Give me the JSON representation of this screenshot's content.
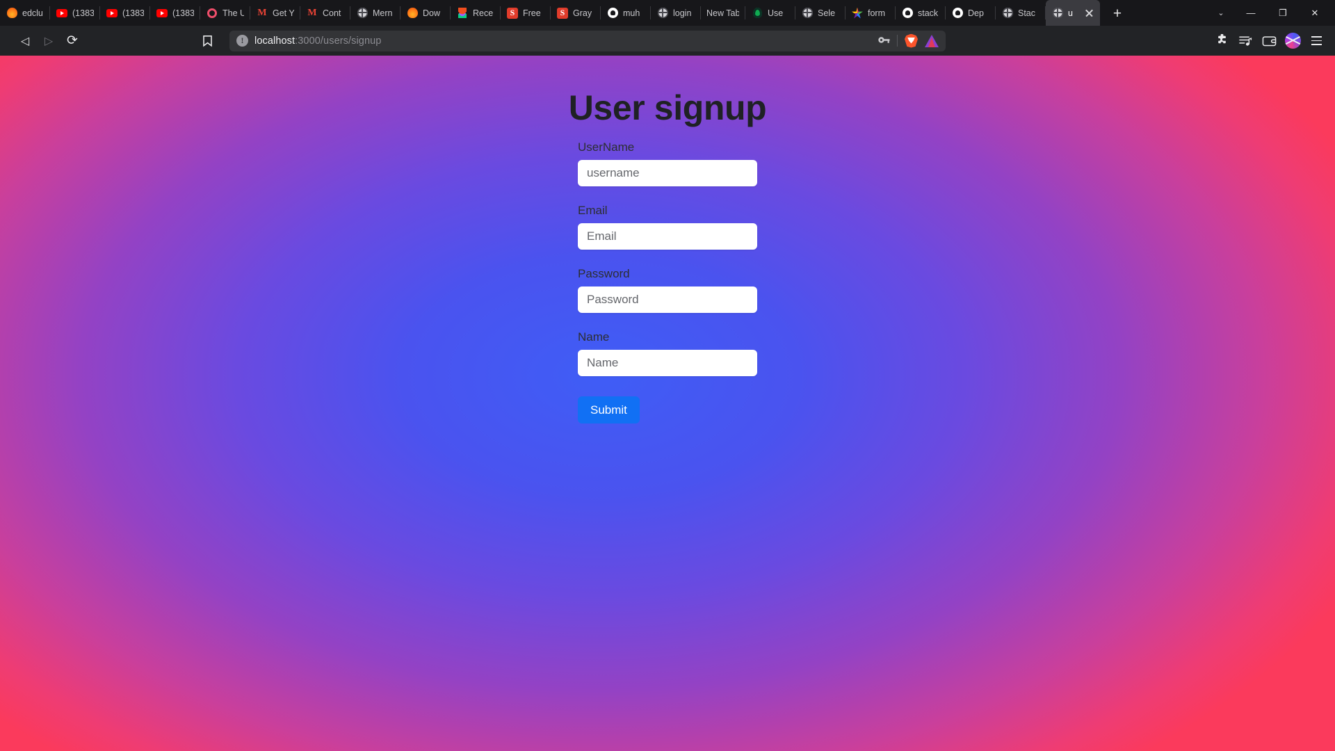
{
  "browser": {
    "tabs": [
      {
        "title": "edclu",
        "icon": "firefox-icon",
        "icon_class": "fav-fire",
        "active": false
      },
      {
        "title": "(1383",
        "icon": "youtube-icon",
        "icon_class": "fav-yt",
        "active": false
      },
      {
        "title": "(1383",
        "icon": "youtube-icon",
        "icon_class": "fav-yt",
        "active": false
      },
      {
        "title": "(1383",
        "icon": "youtube-icon",
        "icon_class": "fav-yt",
        "active": false
      },
      {
        "title": "The U",
        "icon": "ring-icon",
        "icon_class": "fav-ring",
        "active": false
      },
      {
        "title": "Get Y",
        "icon": "gmail-icon",
        "icon_class": "fav-gmail",
        "active": false
      },
      {
        "title": "Cont",
        "icon": "gmail-icon",
        "icon_class": "fav-gmail",
        "active": false
      },
      {
        "title": "Mern",
        "icon": "globe-icon",
        "icon_class": "fav-globe",
        "active": false
      },
      {
        "title": "Dow",
        "icon": "firefox-icon",
        "icon_class": "fav-fire",
        "active": false
      },
      {
        "title": "Rece",
        "icon": "figma-icon",
        "icon_class": "fav-figma",
        "active": false
      },
      {
        "title": "Free",
        "icon": "s-icon",
        "icon_class": "fav-s",
        "active": false
      },
      {
        "title": "Gray",
        "icon": "s-icon",
        "icon_class": "fav-s",
        "active": false
      },
      {
        "title": "muh",
        "icon": "github-icon",
        "icon_class": "fav-gh",
        "active": false
      },
      {
        "title": "login",
        "icon": "globe-icon",
        "icon_class": "fav-globe",
        "active": false
      },
      {
        "title": "New Tab",
        "icon": "none",
        "icon_class": "fav-none",
        "active": false
      },
      {
        "title": "Use",
        "icon": "mongodb-icon",
        "icon_class": "fav-leaf",
        "active": false
      },
      {
        "title": "Sele",
        "icon": "globe-icon",
        "icon_class": "fav-globe",
        "active": false
      },
      {
        "title": "form",
        "icon": "star-icon",
        "icon_class": "fav-star",
        "active": false
      },
      {
        "title": "stack",
        "icon": "github-icon",
        "icon_class": "fav-gh",
        "active": false
      },
      {
        "title": "Dep",
        "icon": "github-icon",
        "icon_class": "fav-gh",
        "active": false
      },
      {
        "title": "Stac",
        "icon": "globe-icon",
        "icon_class": "fav-globe",
        "active": false
      },
      {
        "title": "u",
        "icon": "globe-icon",
        "icon_class": "fav-globe",
        "active": true
      }
    ],
    "new_tab_label": "+",
    "window_controls": {
      "tab_list_chevron": "⌄",
      "minimize": "—",
      "maximize": "❐",
      "close": "✕"
    },
    "nav": {
      "back": "◁",
      "forward": "▷",
      "reload": "⟳",
      "bookmark": "☐"
    },
    "url": {
      "host": "localhost",
      "path": ":3000/users/signup",
      "full": "localhost:3000/users/signup",
      "info_icon": "not-secure-icon",
      "info_glyph": "!",
      "password_key_icon": "⚷",
      "shield_icon": "brave-shield-icon",
      "reward_icon": "brave-rewards-icon"
    },
    "toolbar_right": [
      {
        "name": "extensions-icon",
        "glyph": "❖"
      },
      {
        "name": "playlist-icon",
        "glyph": "☰"
      },
      {
        "name": "wallet-icon",
        "glyph": "▤"
      },
      {
        "name": "profile-avatar",
        "glyph": ""
      },
      {
        "name": "app-menu-icon",
        "glyph": "≡"
      }
    ]
  },
  "page": {
    "title": "User signup",
    "fields": [
      {
        "label": "UserName",
        "placeholder": "username",
        "value": "",
        "type": "text",
        "name": "username"
      },
      {
        "label": "Email",
        "placeholder": "Email",
        "value": "",
        "type": "text",
        "name": "email"
      },
      {
        "label": "Password",
        "placeholder": "Password",
        "value": "",
        "type": "text",
        "name": "password"
      },
      {
        "label": "Name",
        "placeholder": "Name",
        "value": "",
        "type": "text",
        "name": "name"
      }
    ],
    "submit_label": "Submit",
    "colors": {
      "submit_bg": "#1170f4",
      "title_color": "#1f2124",
      "gradient_center": "#3f5df6",
      "gradient_edge": "#fb3a5c"
    }
  }
}
